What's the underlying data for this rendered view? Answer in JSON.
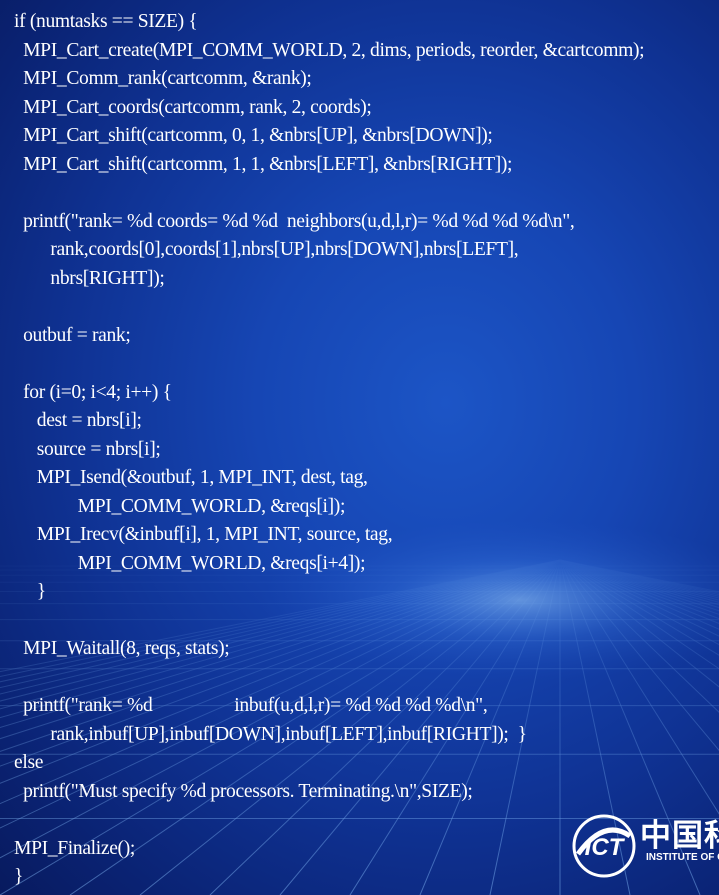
{
  "slide": {
    "code_lines": [
      "if (numtasks == SIZE) {",
      "  MPI_Cart_create(MPI_COMM_WORLD, 2, dims, periods, reorder, &cartcomm);",
      "  MPI_Comm_rank(cartcomm, &rank);",
      "  MPI_Cart_coords(cartcomm, rank, 2, coords);",
      "  MPI_Cart_shift(cartcomm, 0, 1, &nbrs[UP], &nbrs[DOWN]);",
      "  MPI_Cart_shift(cartcomm, 1, 1, &nbrs[LEFT], &nbrs[RIGHT]);",
      "",
      "  printf(\"rank= %d coords= %d %d  neighbors(u,d,l,r)= %d %d %d %d\\n\",",
      "        rank,coords[0],coords[1],nbrs[UP],nbrs[DOWN],nbrs[LEFT],",
      "        nbrs[RIGHT]);",
      "",
      "  outbuf = rank;",
      "",
      "  for (i=0; i<4; i++) {",
      "     dest = nbrs[i];",
      "     source = nbrs[i];",
      "     MPI_Isend(&outbuf, 1, MPI_INT, dest, tag,",
      "              MPI_COMM_WORLD, &reqs[i]);",
      "     MPI_Irecv(&inbuf[i], 1, MPI_INT, source, tag,",
      "              MPI_COMM_WORLD, &reqs[i+4]);",
      "     }",
      "",
      "  MPI_Waitall(8, reqs, stats);",
      "",
      "  printf(\"rank= %d                  inbuf(u,d,l,r)= %d %d %d %d\\n\",",
      "        rank,inbuf[UP],inbuf[DOWN],inbuf[LEFT],inbuf[RIGHT]);  }",
      "else",
      "  printf(\"Must specify %d processors. Terminating.\\n\",SIZE);",
      "",
      "MPI_Finalize();",
      "}"
    ],
    "logo": {
      "text": "ICT",
      "chinese_text": "中国科",
      "english_text": "INSTITUTE OF CO"
    }
  },
  "colors": {
    "text": "#ffffff",
    "background": "#1646b4",
    "grid": "#7fb8ff"
  }
}
